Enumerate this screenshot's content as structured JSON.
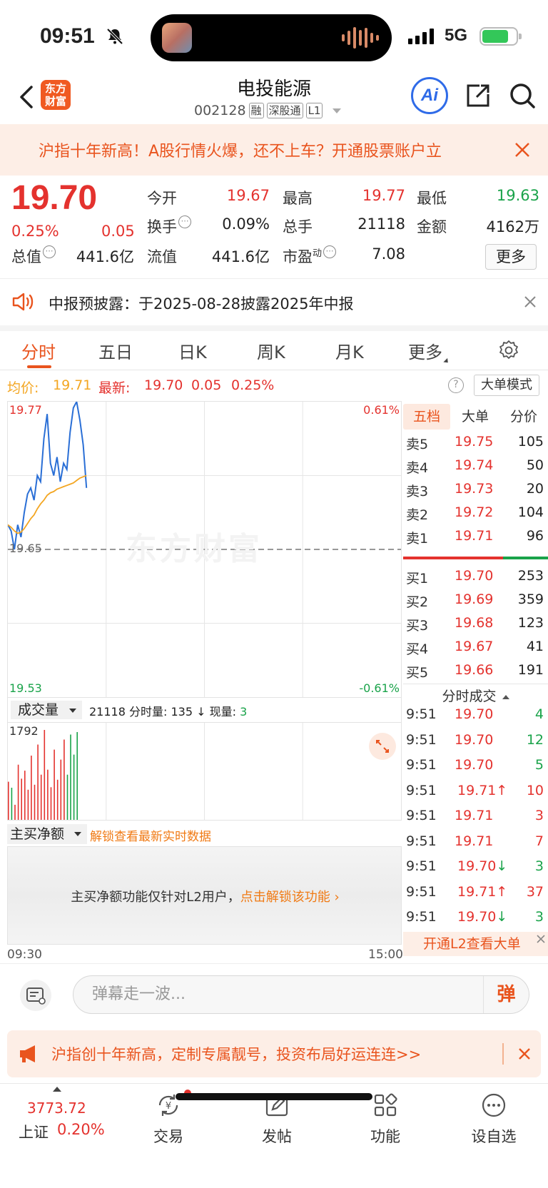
{
  "status": {
    "time": "09:51",
    "network": "5G"
  },
  "header": {
    "logo_line1": "东方",
    "logo_line2": "财富",
    "stock_name": "电投能源",
    "stock_code": "002128",
    "tags": [
      "融",
      "深股通",
      "L1"
    ],
    "ai_label": "Ai"
  },
  "promo": {
    "text": "沪指十年新高！A股行情火爆，还不上车？开通股票账户立"
  },
  "quote": {
    "price": "19.70",
    "pct": "0.25%",
    "change": "0.05",
    "open_label": "今开",
    "open": "19.67",
    "high_label": "最高",
    "high": "19.77",
    "low_label": "最低",
    "low": "19.63",
    "turnover_label": "换手",
    "turnover": "0.09%",
    "volume_label": "总手",
    "volume": "21118",
    "amount_label": "金额",
    "amount": "4162万",
    "mktcap_label": "总值",
    "mktcap": "441.6亿",
    "float_label": "流值",
    "float": "441.6亿",
    "pe_label": "市盈",
    "pe_sup": "动",
    "pe": "7.08",
    "more_label": "更多"
  },
  "notice": {
    "text": "中报预披露：于2025-08-28披露2025年中报"
  },
  "tabs": [
    "分时",
    "五日",
    "日K",
    "周K",
    "月K",
    "更多"
  ],
  "infoline": {
    "avg_label": "均价:",
    "avg": "19.71",
    "latest_label": "最新:",
    "latest": "19.70",
    "chg": "0.05",
    "pct": "0.25%",
    "help": "?",
    "big_order_mode": "大单模式"
  },
  "chart": {
    "watermark": "东方财富",
    "y_high": "19.77",
    "y_mid": "19.65",
    "y_low": "19.53",
    "pct_high": "0.61%",
    "pct_low": "-0.61%",
    "vol_select": "成交量",
    "vol_info_total": "21118",
    "vol_info_minute_label": "分时量:",
    "vol_info_minute": "135",
    "vol_info_now_label": "现量:",
    "vol_info_now": "3",
    "vol_max": "1792",
    "net_select": "主买净额",
    "net_unlock": "解锁查看最新实时数据",
    "net_msg": "主买净额功能仅针对L2用户，",
    "net_msg_link": "点击解锁该功能",
    "time_start": "09:30",
    "time_end": "15:00"
  },
  "chart_data": {
    "type": "line",
    "title": "",
    "series": [
      {
        "name": "",
        "values": [
          19.67,
          19.665,
          19.65,
          19.67,
          19.66,
          19.68,
          19.695,
          19.7,
          19.69,
          19.71,
          19.705,
          19.74,
          19.76,
          19.72,
          19.71,
          19.725,
          19.705,
          19.72,
          19.715,
          19.745,
          19.765,
          19.77,
          19.755,
          19.735,
          19.7
        ]
      },
      {
        "name": "均价",
        "values": [
          19.67,
          19.668,
          19.665,
          19.663,
          19.664,
          19.667,
          19.671,
          19.675,
          19.678,
          19.683,
          19.687,
          19.69,
          19.694,
          19.696,
          19.697,
          19.699,
          19.7,
          19.701,
          19.702,
          19.703,
          19.704,
          19.706,
          19.708,
          19.709,
          19.71
        ]
      }
    ],
    "volume": [
      760,
      640,
      300,
      1100,
      820,
      980,
      600,
      1280,
      700,
      1500,
      900,
      1792,
      1000,
      650,
      1400,
      800,
      1200,
      1600,
      900,
      1700,
      1300,
      1750
    ],
    "volume_colors": [
      "r",
      "g",
      "r",
      "r",
      "r",
      "r",
      "r",
      "r",
      "r",
      "r",
      "r",
      "r",
      "r",
      "r",
      "r",
      "r",
      "r",
      "r",
      "g",
      "g",
      "g",
      "g"
    ],
    "ylim": [
      19.53,
      19.77
    ],
    "xlabel": "",
    "ylabel": ""
  },
  "book": {
    "tabs": [
      "五档",
      "大单",
      "分价"
    ],
    "sells": [
      {
        "label": "卖5",
        "price": "19.75",
        "vol": "105"
      },
      {
        "label": "卖4",
        "price": "19.74",
        "vol": "50"
      },
      {
        "label": "卖3",
        "price": "19.73",
        "vol": "20"
      },
      {
        "label": "卖2",
        "price": "19.72",
        "vol": "104"
      },
      {
        "label": "卖1",
        "price": "19.71",
        "vol": "96"
      }
    ],
    "buys": [
      {
        "label": "买1",
        "price": "19.70",
        "vol": "253"
      },
      {
        "label": "买2",
        "price": "19.69",
        "vol": "359"
      },
      {
        "label": "买3",
        "price": "19.68",
        "vol": "123"
      },
      {
        "label": "买4",
        "price": "19.67",
        "vol": "41"
      },
      {
        "label": "买5",
        "price": "19.66",
        "vol": "191"
      }
    ],
    "tick_header": "分时成交",
    "ticks": [
      {
        "time": "9:51",
        "price": "19.70",
        "vol": "4",
        "dir": "",
        "color": "green"
      },
      {
        "time": "9:51",
        "price": "19.70",
        "vol": "12",
        "dir": "",
        "color": "green"
      },
      {
        "time": "9:51",
        "price": "19.70",
        "vol": "5",
        "dir": "",
        "color": "green"
      },
      {
        "time": "9:51",
        "price": "19.71↑",
        "vol": "10",
        "dir": "up",
        "color": "red"
      },
      {
        "time": "9:51",
        "price": "19.71",
        "vol": "3",
        "dir": "",
        "color": "red"
      },
      {
        "time": "9:51",
        "price": "19.71",
        "vol": "7",
        "dir": "",
        "color": "red"
      },
      {
        "time": "9:51",
        "price": "19.70↓",
        "vol": "3",
        "dir": "down",
        "color": "green"
      },
      {
        "time": "9:51",
        "price": "19.71↑",
        "vol": "37",
        "dir": "up",
        "color": "red"
      },
      {
        "time": "9:51",
        "price": "19.70↓",
        "vol": "3",
        "dir": "down",
        "color": "green"
      }
    ],
    "l2_btn": "开通L2查看大单"
  },
  "danmu": {
    "placeholder": "弹幕走一波...",
    "send": "弹"
  },
  "ad": {
    "text": "沪指创十年新高，定制专属靓号，投资布局好运连连>>"
  },
  "nav": {
    "index_value": "3773.72",
    "index_name": "上证",
    "index_pct": "0.20%",
    "items": [
      "交易",
      "发帖",
      "功能",
      "设自选"
    ]
  },
  "colors": {
    "up": "#e4322e",
    "down": "#1aa34a",
    "accent": "#e9541e",
    "avg_line": "#f3a622",
    "price_line": "#2a6fd6"
  }
}
